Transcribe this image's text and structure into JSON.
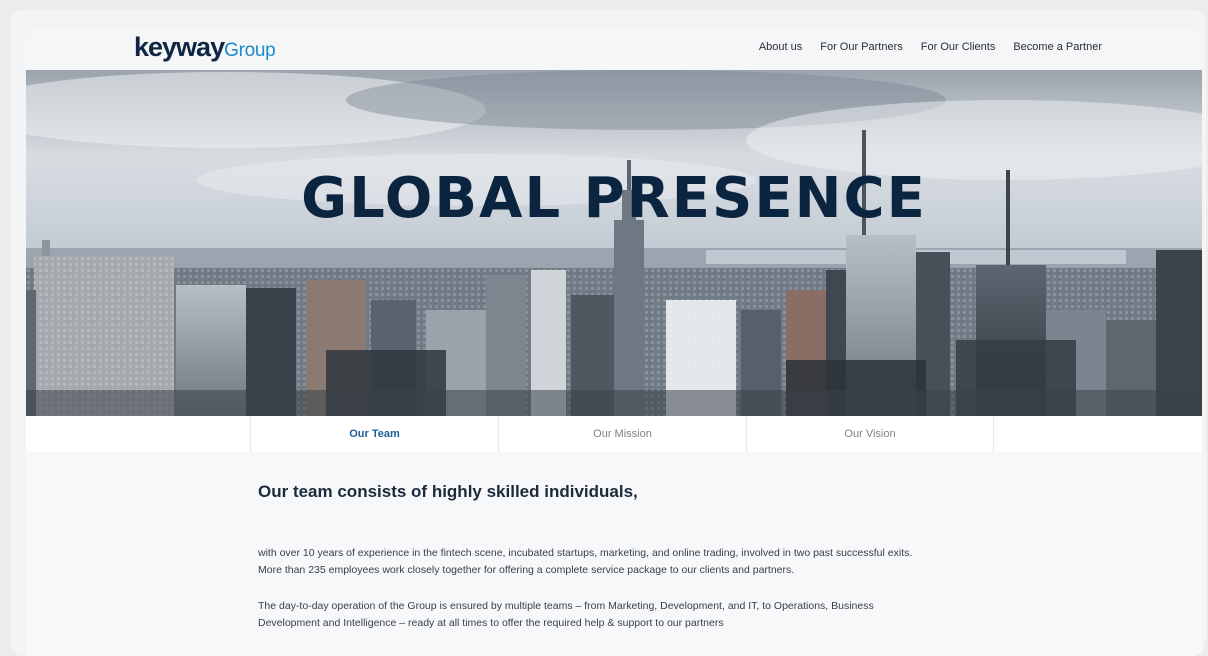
{
  "header": {
    "logo_main": "keyway",
    "logo_sub": "Group",
    "nav": [
      "About us",
      "For Our Partners",
      "For Our Clients",
      "Become a Partner"
    ]
  },
  "hero": {
    "title": "GLOBAL PRESENCE"
  },
  "tabs": {
    "items": [
      "Our Team",
      "Our Mission",
      "Our Vision"
    ],
    "active": "Our Team"
  },
  "content": {
    "heading": "Our team consists of highly skilled individuals,",
    "p1_line1": "with over 10 years of experience in the fintech scene, incubated startups, marketing, and online trading, involved in two past successful exits.",
    "p1_line2": "More than 235 employees work closely together for offering a complete service package to our clients and partners.",
    "p2_line1": "The day-to-day operation of the Group is ensured by multiple teams – from Marketing, Development, and IT, to Operations, Business",
    "p2_line2": "Development and Intelligence – ready at all times to offer the required help & support to our partners"
  },
  "colors": {
    "brand_dark": "#0f2742",
    "brand_accent": "#1e88c9",
    "tab_active": "#1d5f98"
  }
}
